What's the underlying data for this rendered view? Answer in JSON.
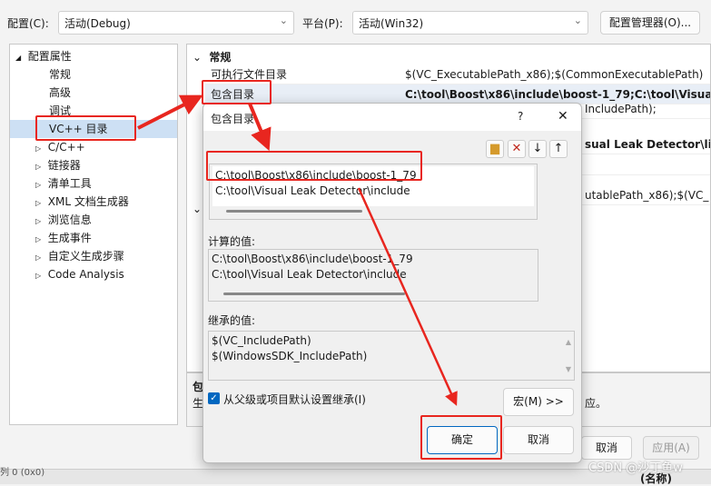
{
  "toolbar": {
    "config_label": "配置(C):",
    "config_value": "活动(Debug)",
    "platform_label": "平台(P):",
    "platform_value": "活动(Win32)",
    "config_manager": "配置管理器(O)..."
  },
  "tree": {
    "root": "配置属性",
    "items": [
      "常规",
      "高级",
      "调试",
      "VC++ 目录",
      "C/C++",
      "链接器",
      "清单工具",
      "XML 文档生成器",
      "浏览信息",
      "生成事件",
      "自定义生成步骤",
      "Code Analysis"
    ]
  },
  "grid": {
    "section": "常规",
    "rows": [
      {
        "key": "可执行文件目录",
        "value": "$(VC_ExecutablePath_x86);$(CommonExecutablePath)"
      },
      {
        "key": "包含目录",
        "value": "C:\\tool\\Boost\\x86\\include\\boost-1_79;C:\\tool\\Visual"
      },
      {
        "key": "",
        "value": "IncludePath);"
      },
      {
        "key": "",
        "value": "sual Leak Detector\\li"
      },
      {
        "key": "",
        "value": ""
      },
      {
        "key": "",
        "value": "utablePath_x86);$(VC_"
      }
    ]
  },
  "desc": {
    "title": "包",
    "text_start": "生",
    "text_end": "应。"
  },
  "footer": {
    "ok": "确定",
    "cancel": "取消",
    "apply": "应用(A)",
    "status": "列 0 (0x0)",
    "name_col": "(名称)"
  },
  "dialog": {
    "title": "包含目录",
    "help": "?",
    "close": "✕",
    "entries": [
      "C:\\tool\\Boost\\x86\\include\\boost-1_79",
      "C:\\tool\\Visual Leak Detector\\include"
    ],
    "computed_label": "计算的值:",
    "computed": [
      "C:\\tool\\Boost\\x86\\include\\boost-1_79",
      "C:\\tool\\Visual Leak Detector\\include"
    ],
    "inherited_label": "继承的值:",
    "inherited": [
      "$(VC_IncludePath)",
      "$(WindowsSDK_IncludePath)"
    ],
    "inherit_checkbox": "从父级或项目默认设置继承(I)",
    "inherit_checked": true,
    "macros": "宏(M) >>",
    "ok": "确定",
    "cancel": "取消"
  },
  "watermark": "CSDN @沙丁鱼w",
  "colors": {
    "annotation": "#e8261f",
    "selected": "#cde0f4",
    "accent": "#0067c0"
  }
}
